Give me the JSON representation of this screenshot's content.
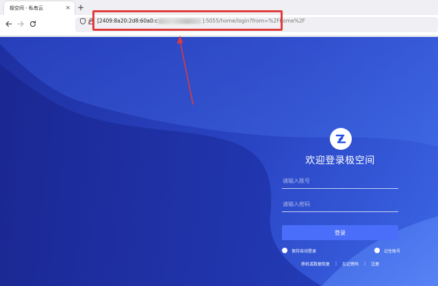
{
  "browser": {
    "tab_title": "极空间 - 私有云",
    "tab_close": "×",
    "new_tab": "+",
    "url_visible_start": "[2409:8a20:2d8:60a0:c",
    "url_visible_end": "]:5055/home/login?from=%2Fhome%2F"
  },
  "login": {
    "title": "欢迎登录极空间",
    "account_placeholder": "请输入账号",
    "password_placeholder": "请输入密码",
    "submit_label": "登录",
    "keep_login_label": "保持自动登录",
    "remember_account_label": "记住账号",
    "links": {
      "recover": "移机或数据恢复",
      "forgot": "忘记密码",
      "register": "注册"
    },
    "separator": "|"
  },
  "icons": {
    "back": "arrow-left-icon",
    "forward": "arrow-right-icon",
    "reload": "reload-icon",
    "shield": "shield-icon",
    "lock": "lock-icon",
    "logo": "zspace-logo-icon"
  },
  "colors": {
    "annotation": "#e03a3a",
    "button": "#4a6ef9",
    "background_dark": "#1e2fa0",
    "background_light": "#3c66e6"
  }
}
